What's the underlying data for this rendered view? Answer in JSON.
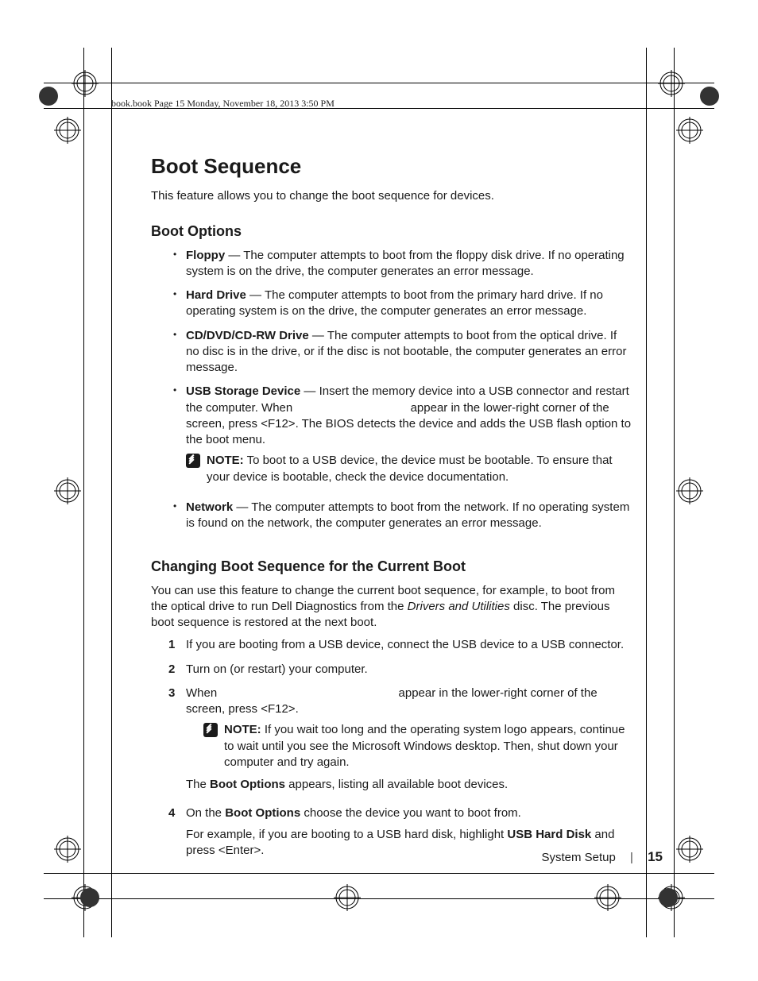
{
  "bookmark": "book.book  Page 15  Monday, November 18, 2013  3:50 PM",
  "h1": "Boot Sequence",
  "intro": "This feature allows you to change the boot sequence for devices.",
  "h2_options": "Boot Options",
  "opts": {
    "floppy": {
      "term": "Floppy",
      "text": " — The computer attempts to boot from the floppy disk drive. If no operating system is on the drive, the computer generates an error message."
    },
    "hdd": {
      "term": "Hard Drive",
      "text": " — The computer attempts to boot from the primary hard drive. If no operating system is on the drive, the computer generates an error message."
    },
    "cd": {
      "term": "CD/DVD/CD-RW Drive",
      "text": " — The computer attempts to boot from the optical drive. If no disc is in the drive, or if the disc is not bootable, the computer generates an error message."
    },
    "usb": {
      "term": "USB Storage Device",
      "text_a": " — Insert the memory device into a USB connector and restart the computer. When ",
      "text_b": " appear in the lower-right corner of the screen, press <F12>. The BIOS detects the device and adds the USB flash option to the boot menu."
    },
    "net": {
      "term": "Network",
      "text": " — The computer attempts to boot from the network. If no operating system is found on the network, the computer generates an error message."
    }
  },
  "note_label": "NOTE:",
  "usb_note": " To boot to a USB device, the device must be bootable. To ensure that your device is bootable, check the device documentation.",
  "h2_changing": "Changing Boot Sequence for the Current Boot",
  "changing_intro_a": "You can use this feature to change the current boot sequence, for example, to boot from the optical drive to run Dell Diagnostics from the ",
  "changing_intro_italic": "Drivers and Utilities",
  "changing_intro_b": " disc. The previous boot sequence is restored at the next boot.",
  "steps": {
    "s1": "If you are booting from a USB device, connect the USB device to a USB connector.",
    "s2": "Turn on (or restart) your computer.",
    "s3a": "When ",
    "s3b": " appear in the lower-right corner of the screen, press <F12>.",
    "s3_note": " If you wait too long and the operating system logo appears, continue to wait until you see the Microsoft Windows desktop. Then, shut down your computer and try again.",
    "s3_after_a": "The ",
    "s3_after_bold": "Boot Options",
    "s3_after_b": " appears, listing all available boot devices.",
    "s4a": "On the ",
    "s4_bold1": "Boot Options",
    "s4b": " choose the device you want to boot from.",
    "s4c": "For example, if you are booting to a USB hard disk, highlight ",
    "s4_bold2": "USB Hard Disk",
    "s4d": " and press <Enter>."
  },
  "footer": {
    "section": "System Setup",
    "page": "15"
  }
}
